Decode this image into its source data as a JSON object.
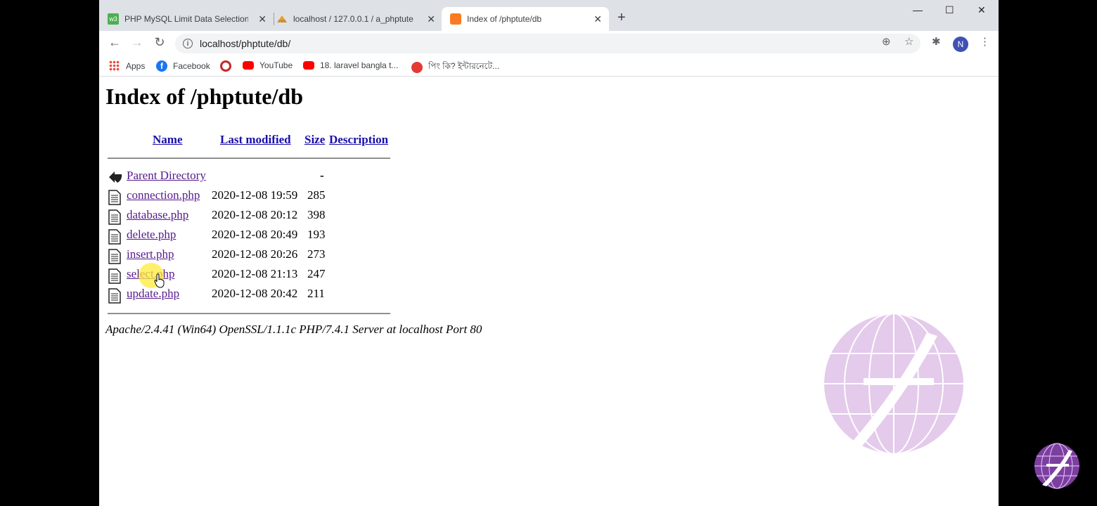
{
  "tabs": [
    {
      "title": "PHP MySQL Limit Data Selections",
      "favicon": "w3schools-icon"
    },
    {
      "title": "localhost / 127.0.0.1 / a_phptute",
      "favicon": "phpmyadmin-icon"
    },
    {
      "title": "Index of /phptute/db",
      "favicon": "xampp-icon",
      "active": true
    }
  ],
  "toolbar": {
    "url": "localhost/phptute/db/",
    "profile_initial": "N"
  },
  "bookmarks": [
    {
      "label": "Apps",
      "icon": "apps-grid-icon"
    },
    {
      "label": "Facebook",
      "icon": "facebook-icon"
    },
    {
      "label": "",
      "icon": "bangladesh-emblem-icon"
    },
    {
      "label": "YouTube",
      "icon": "youtube-icon"
    },
    {
      "label": "18. laravel bangla t...",
      "icon": "youtube-icon"
    },
    {
      "label": "পিং কি? ইন্টারনেটে...",
      "icon": "blog-icon"
    }
  ],
  "page": {
    "heading": "Index of /phptute/db",
    "columns": {
      "name": "Name",
      "modified": "Last modified",
      "size": "Size",
      "description": "Description"
    },
    "parent": {
      "label": "Parent Directory",
      "size": "-"
    },
    "files": [
      {
        "name": "connection.php",
        "modified": "2020-12-08 19:59",
        "size": "285"
      },
      {
        "name": "database.php",
        "modified": "2020-12-08 20:12",
        "size": "398"
      },
      {
        "name": "delete.php",
        "modified": "2020-12-08 20:49",
        "size": "193"
      },
      {
        "name": "insert.php",
        "modified": "2020-12-08 20:26",
        "size": "273"
      },
      {
        "name": "select.php",
        "modified": "2020-12-08 21:13",
        "size": "247"
      },
      {
        "name": "update.php",
        "modified": "2020-12-08 20:42",
        "size": "211"
      }
    ],
    "footer": "Apache/2.4.41 (Win64) OpenSSL/1.1.1c PHP/7.4.1 Server at localhost Port 80"
  },
  "colors": {
    "tabstrip": "#dee1e6",
    "link": "#551a8b",
    "header_link": "#1a0dab",
    "watermark": "#b36bc7"
  }
}
